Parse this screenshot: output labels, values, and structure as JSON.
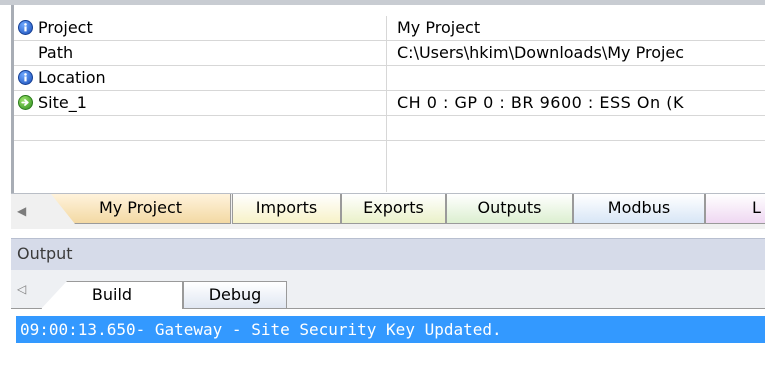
{
  "properties": {
    "rows": [
      {
        "name": "Project",
        "value": "My Project",
        "icon": "info-icon"
      },
      {
        "name": "Path",
        "value": "C:\\Users\\hkim\\Downloads\\My Projec",
        "icon": ""
      },
      {
        "name": "Location",
        "value": "",
        "icon": "info-icon"
      },
      {
        "name": "Site_1",
        "value": "CH 0 : GP 0 : BR 9600 : ESS On (K",
        "icon": "go-icon"
      },
      {
        "name": "",
        "value": "",
        "icon": ""
      }
    ]
  },
  "project_tabs": [
    {
      "label": "My Project",
      "color": "#f6dfb0"
    },
    {
      "label": "Imports",
      "color": "#f7f2c8"
    },
    {
      "label": "Exports",
      "color": "#eaf1c9"
    },
    {
      "label": "Outputs",
      "color": "#dcefd0"
    },
    {
      "label": "Modbus",
      "color": "#d8e6f6"
    },
    {
      "label": "L",
      "color": "#efd8f2"
    }
  ],
  "output": {
    "title": "Output",
    "tabs": [
      {
        "label": "Build"
      },
      {
        "label": "Debug"
      }
    ],
    "log": [
      "09:00:13.650- Gateway - Site Security Key Updated."
    ]
  }
}
